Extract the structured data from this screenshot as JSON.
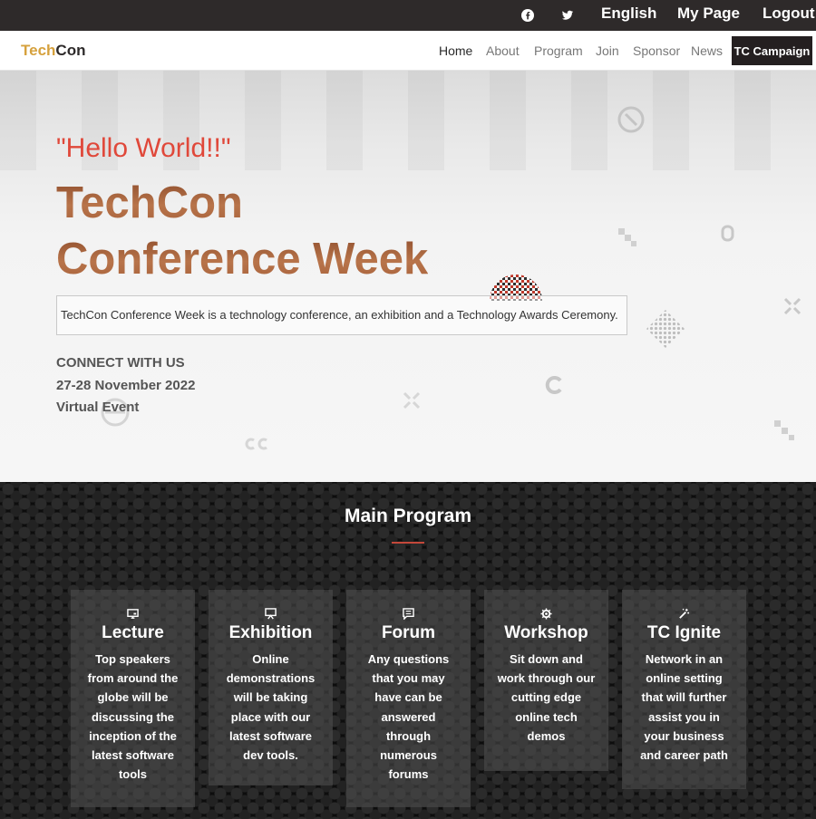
{
  "topbar": {
    "social": [
      "facebook-icon",
      "twitter-icon"
    ],
    "language": "English",
    "my_page": "My Page",
    "logout": "Logout"
  },
  "brand": {
    "part1": "Tech",
    "part2": "Con"
  },
  "nav": {
    "items": [
      "Home",
      "About",
      "Program",
      "Join",
      "Sponsor",
      "News"
    ],
    "active": "Home",
    "campaign": "TC Campaign"
  },
  "hero": {
    "greeting": "\"Hello World!!\"",
    "title_line1": "TechCon",
    "title_line2": "Conference Week",
    "description": "TechCon Conference Week is a technology conference, an exhibition and a Technology Awards Ceremony.",
    "connect": "CONNECT WITH US",
    "dates": "27-28 November 2022",
    "format": "Virtual Event"
  },
  "program": {
    "title": "Main Program",
    "accent_color": "#c4483a",
    "cards": [
      {
        "icon": "screen-icon",
        "title": "Lecture",
        "text": "Top speakers from around the globe will be discussing the inception of the latest software tools"
      },
      {
        "icon": "presentation-icon",
        "title": "Exhibition",
        "text": "Online demonstrations will be taking place with our latest software dev tools."
      },
      {
        "icon": "chat-icon",
        "title": "Forum",
        "text": "Any questions that you may have can be answered through numerous forums"
      },
      {
        "icon": "gear-icon",
        "title": "Workshop",
        "text": "Sit down and work through our cutting edge online tech demos"
      },
      {
        "icon": "magic-wand-icon",
        "title": "TC Ignite",
        "text": "Network in an online setting that will further assist you in your business and career path"
      }
    ]
  },
  "colors": {
    "topbar": "#2e2a2a",
    "brand_accent": "#d6a13d",
    "title": "#a35b34",
    "greeting": "#e0483a"
  }
}
